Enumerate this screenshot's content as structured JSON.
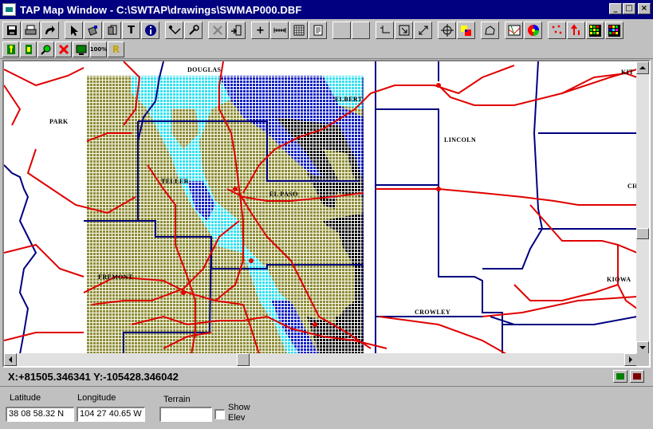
{
  "window": {
    "title": "TAP Map Window - C:\\SWTAP\\drawings\\SWMAP000.DBF",
    "minimize_glyph": "_",
    "maximize_glyph": "□",
    "close_glyph": "×"
  },
  "toolbar1": {
    "text_tool_glyph": "T",
    "info_glyph": "i",
    "zoom_in_glyph": "+"
  },
  "toolbar2": {
    "zoom100_label": "100%",
    "r_label": "R"
  },
  "map": {
    "labels": {
      "douglas": "DOUGLAS",
      "elbert": "ELBERT",
      "park": "PARK",
      "lincoln": "LINCOLN",
      "kit": "KIT",
      "ch": "CH",
      "kiowa": "KIOWA",
      "crowley": "CROWLEY",
      "teller": "TELLER",
      "el_paso": "EL PASO",
      "fremont": "FREMONT"
    },
    "colors": {
      "grid_olive": "#8c8c3c",
      "cyan": "#33e0f0",
      "blue": "#1020c0",
      "roads": "#e00000",
      "boundaries": "#000080"
    }
  },
  "status": {
    "coords": "X:+81505.346341 Y:-105428.346042"
  },
  "bottom": {
    "latitude_label": "Latitude",
    "latitude_value": "38 08 58.32 N",
    "longitude_label": "Longitude",
    "longitude_value": "104 27 40.65 W",
    "terrain_label": "Terrain",
    "terrain_value": "",
    "show_elev_label_1": "Show",
    "show_elev_label_2": "Elev"
  }
}
